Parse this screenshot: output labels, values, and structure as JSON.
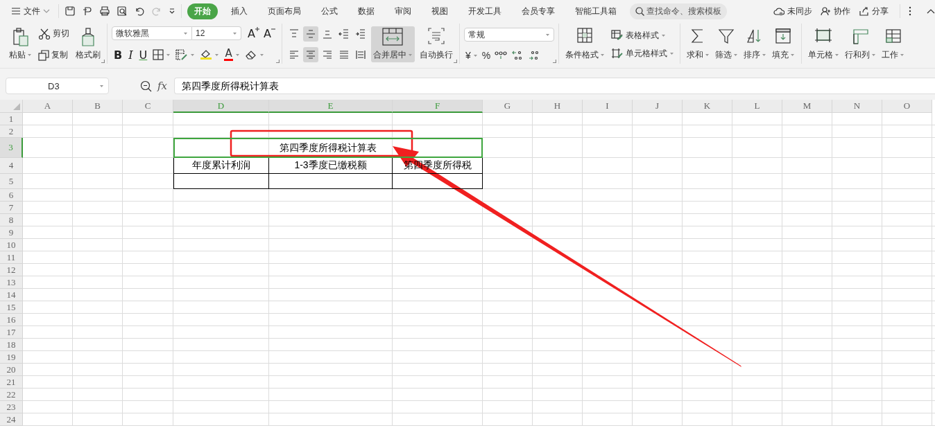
{
  "menu_bar": {
    "file_menu": "文件",
    "tabs": [
      {
        "label": "开始",
        "selected": true
      },
      {
        "label": "插入",
        "selected": false
      },
      {
        "label": "页面布局",
        "selected": false
      },
      {
        "label": "公式",
        "selected": false
      },
      {
        "label": "数据",
        "selected": false
      },
      {
        "label": "审阅",
        "selected": false
      },
      {
        "label": "视图",
        "selected": false
      },
      {
        "label": "开发工具",
        "selected": false
      },
      {
        "label": "会员专享",
        "selected": false
      },
      {
        "label": "智能工具箱",
        "selected": false
      }
    ],
    "search": {
      "placeholder": "查找命令、搜索模板"
    },
    "actions": [
      "未同步",
      "协作",
      "分享"
    ]
  },
  "ribbon": {
    "clipboard": {
      "paste": "粘贴",
      "cut": "剪切",
      "copy": "复制",
      "format_painter": "格式刷"
    },
    "font": {
      "name": "微软雅黑",
      "size": "12",
      "grow": "A",
      "shrink": "A",
      "bold": "B",
      "italic": "I",
      "underline": "U",
      "font_color": "A"
    },
    "alignment": {
      "buttons": [
        {
          "kind": "top",
          "selected": false
        },
        {
          "kind": "middle",
          "selected": true
        },
        {
          "kind": "bottom",
          "selected": false
        },
        {
          "kind": "outdent",
          "selected": false
        },
        {
          "kind": "indent",
          "selected": false
        },
        {
          "kind": "left",
          "selected": false
        },
        {
          "kind": "center",
          "selected": true
        },
        {
          "kind": "right",
          "selected": false
        },
        {
          "kind": "justify",
          "selected": false
        },
        {
          "kind": "distribute",
          "selected": false
        }
      ],
      "merge": {
        "label": "合并居中",
        "selected": true
      },
      "wrap": "自动换行"
    },
    "number": {
      "format": "常规",
      "currency": "¥",
      "percent": "%"
    },
    "styles": {
      "conditional": "条件格式",
      "table_style": "表格样式",
      "cell_style": "单元格样式"
    },
    "tools": [
      "求和",
      "筛选",
      "排序",
      "填充"
    ],
    "cells": [
      "单元格",
      "行和列",
      "工作"
    ]
  },
  "formula_bar": {
    "cell_ref": "D3",
    "fx": "fx",
    "value": "第四季度所得税计算表"
  },
  "sheet": {
    "columns": [
      {
        "label": "A",
        "selected": false
      },
      {
        "label": "B",
        "selected": false
      },
      {
        "label": "C",
        "selected": false
      },
      {
        "label": "D",
        "selected": true
      },
      {
        "label": "E",
        "selected": true
      },
      {
        "label": "F",
        "selected": true
      },
      {
        "label": "G",
        "selected": false
      },
      {
        "label": "H",
        "selected": false
      },
      {
        "label": "I",
        "selected": false
      },
      {
        "label": "J",
        "selected": false
      },
      {
        "label": "K",
        "selected": false
      },
      {
        "label": "L",
        "selected": false
      },
      {
        "label": "M",
        "selected": false
      },
      {
        "label": "N",
        "selected": false
      },
      {
        "label": "O",
        "selected": false
      }
    ],
    "rows": [
      {
        "label": "1",
        "selected": false
      },
      {
        "label": "2",
        "selected": false
      },
      {
        "label": "3",
        "selected": true
      },
      {
        "label": "4",
        "selected": false
      },
      {
        "label": "5",
        "selected": false
      },
      {
        "label": "6",
        "selected": false
      },
      {
        "label": "7",
        "selected": false
      },
      {
        "label": "8",
        "selected": false
      },
      {
        "label": "9",
        "selected": false
      },
      {
        "label": "10",
        "selected": false
      },
      {
        "label": "11",
        "selected": false
      },
      {
        "label": "12",
        "selected": false
      },
      {
        "label": "13",
        "selected": false
      },
      {
        "label": "14",
        "selected": false
      },
      {
        "label": "15",
        "selected": false
      },
      {
        "label": "16",
        "selected": false
      },
      {
        "label": "17",
        "selected": false
      },
      {
        "label": "18",
        "selected": false
      },
      {
        "label": "19",
        "selected": false
      },
      {
        "label": "20",
        "selected": false
      },
      {
        "label": "21",
        "selected": false
      },
      {
        "label": "22",
        "selected": false
      },
      {
        "label": "23",
        "selected": false
      },
      {
        "label": "24",
        "selected": false
      }
    ],
    "table": {
      "title": {
        "text": "第四季度所得税计算表",
        "selected": true
      },
      "columns": [
        "年度累计利润",
        "1-3季度已缴税额",
        "第四季度所得税"
      ]
    }
  }
}
